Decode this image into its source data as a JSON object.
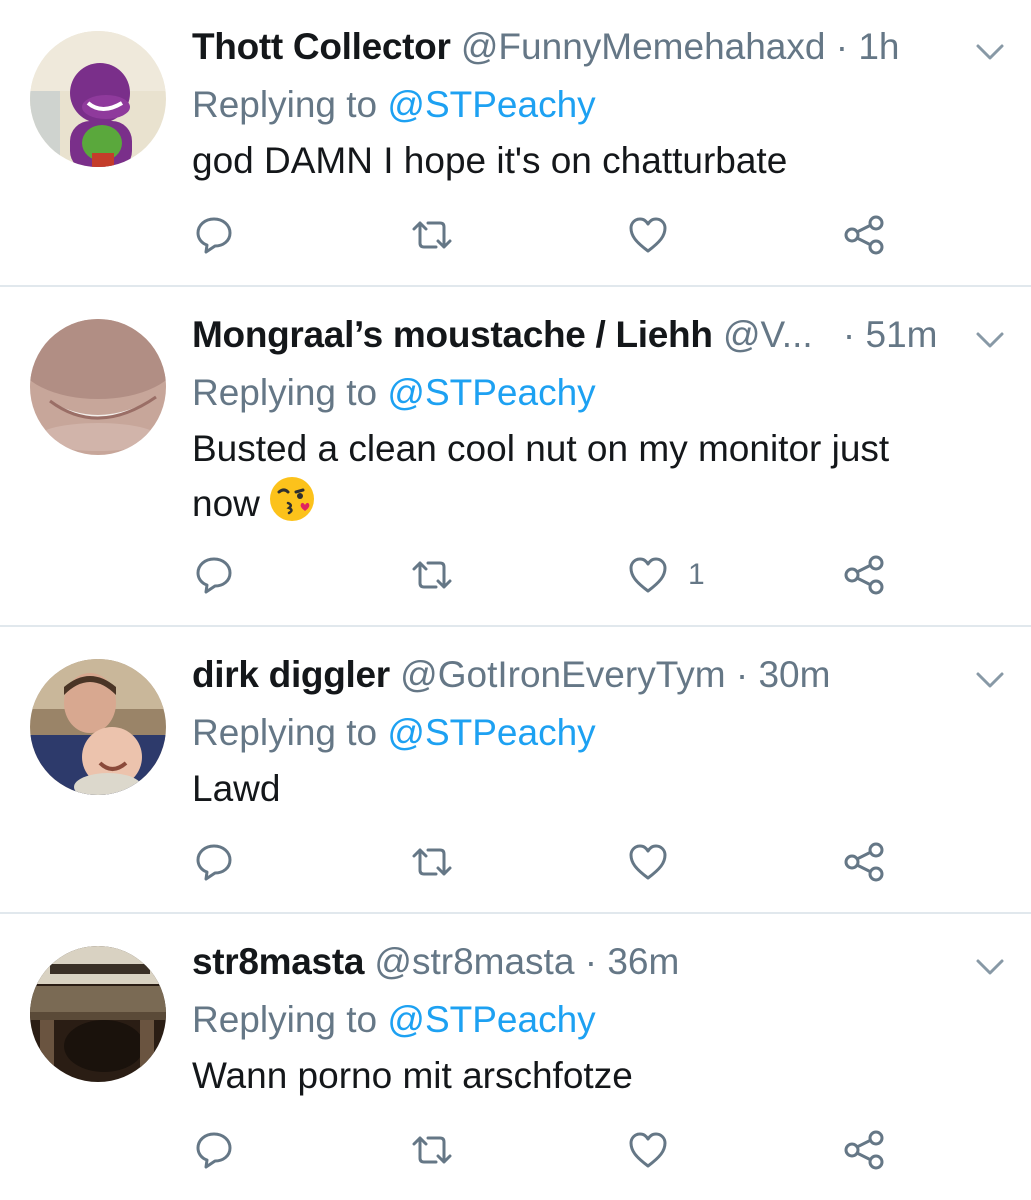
{
  "tweets": [
    {
      "display_name": "Thott Collector",
      "handle": "@FunnyMemehahaxd",
      "separator": "·",
      "time": "1h",
      "replying_prefix": "Replying to",
      "replying_to": "@STPeachy",
      "text": "god DAMN I hope it's on chatturbate",
      "like_count": ""
    },
    {
      "display_name": "Mongraal’s moustache / Liehh",
      "handle": "@V...",
      "separator": "·",
      "time": "51m",
      "replying_prefix": "Replying to",
      "replying_to": "@STPeachy",
      "text_line1": "Busted a clean cool nut on my monitor just",
      "text_line2": "now",
      "emoji": "face-blowing-a-kiss",
      "like_count": "1"
    },
    {
      "display_name": "dirk diggler",
      "handle": "@GotIronEveryTym",
      "separator": "·",
      "time": "30m",
      "replying_prefix": "Replying to",
      "replying_to": "@STPeachy",
      "text": "Lawd",
      "like_count": ""
    },
    {
      "display_name": "str8masta",
      "handle": "@str8masta",
      "separator": "·",
      "time": "36m",
      "replying_prefix": "Replying to",
      "replying_to": "@STPeachy",
      "text": "Wann porno mit arschfotze",
      "like_count": ""
    }
  ],
  "icons": {
    "reply": "reply-icon",
    "retweet": "retweet-icon",
    "like": "heart-icon",
    "share": "share-icon",
    "more": "chevron-down-icon"
  },
  "colors": {
    "link": "#1da1f2",
    "secondary": "#657786",
    "divider": "#e1e8ed"
  }
}
